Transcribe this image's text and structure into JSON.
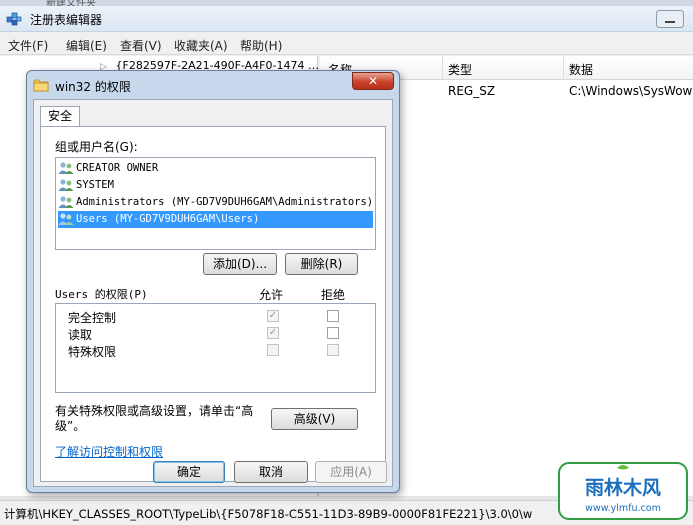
{
  "regedit": {
    "top_strip_text": "新建文件夹",
    "title": "注册表编辑器",
    "minimize_glyph": "—",
    "menu": [
      "文件(F)",
      "编辑(E)",
      "查看(V)",
      "收藏夹(A)",
      "帮助(H)"
    ],
    "tree_row": "{F282597F-2A21-490F-A4F0-1474",
    "tree_row_suffix": "…",
    "columns": [
      "名称",
      "类型",
      "数据"
    ],
    "row": {
      "name": "",
      "type": "REG_SZ",
      "data": "C:\\Windows\\SysWow"
    },
    "status_text": "计算机\\HKEY_CLASSES_ROOT\\TypeLib\\{F5078F18-C551-11D3-89B9-0000F81FE221}\\3.0\\0\\w"
  },
  "dialog": {
    "title": "win32 的权限",
    "close_glyph": "✕",
    "tab": "安全",
    "groups_label": "组或用户名(G):",
    "users": [
      "CREATOR OWNER",
      "SYSTEM",
      "Administrators (MY-GD7V9DUH6GAM\\Administrators)",
      "Users (MY-GD7V9DUH6GAM\\Users)"
    ],
    "selected_user_index": 3,
    "add_button": "添加(D)...",
    "remove_button": "删除(R)",
    "perm_header": "Users 的权限(P)",
    "allow_label": "允许",
    "deny_label": "拒绝",
    "permissions": [
      {
        "name": "完全控制",
        "allow": true,
        "deny": false
      },
      {
        "name": "读取",
        "allow": true,
        "deny": false
      },
      {
        "name": "特殊权限",
        "allow": false,
        "deny": false
      }
    ],
    "check_glyph": "✓",
    "special_text": "有关特殊权限或高级设置，请单击“高级”。",
    "advanced_button": "高级(V)",
    "learn_link": "了解访问控制和权限",
    "ok_button": "确定",
    "cancel_button": "取消",
    "apply_button": "应用(A)"
  },
  "watermark": {
    "brand": "雨林木风",
    "url": "www.ylmfu.com"
  }
}
